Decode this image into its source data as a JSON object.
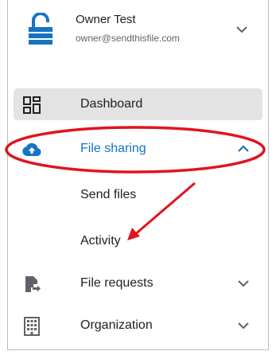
{
  "account": {
    "name": "Owner Test",
    "email": "owner@sendthisfile.com",
    "icon": "lock-icon",
    "expand_icon": "chevron-down-icon"
  },
  "nav": {
    "items": [
      {
        "label": "Dashboard",
        "icon": "dashboard-icon",
        "active": true
      },
      {
        "label": "File sharing",
        "icon": "cloud-upload-icon",
        "expanded": true,
        "color": "#1673c4"
      },
      {
        "label": "File requests",
        "icon": "file-request-icon",
        "expanded": false
      },
      {
        "label": "Organization",
        "icon": "building-icon",
        "expanded": false
      }
    ],
    "file_sharing_sub": [
      {
        "label": "Send files"
      },
      {
        "label": "Activity"
      }
    ]
  },
  "colors": {
    "accent_blue": "#1673c4",
    "annotation_red": "#e0141e",
    "active_bg": "#e3e3e3"
  }
}
